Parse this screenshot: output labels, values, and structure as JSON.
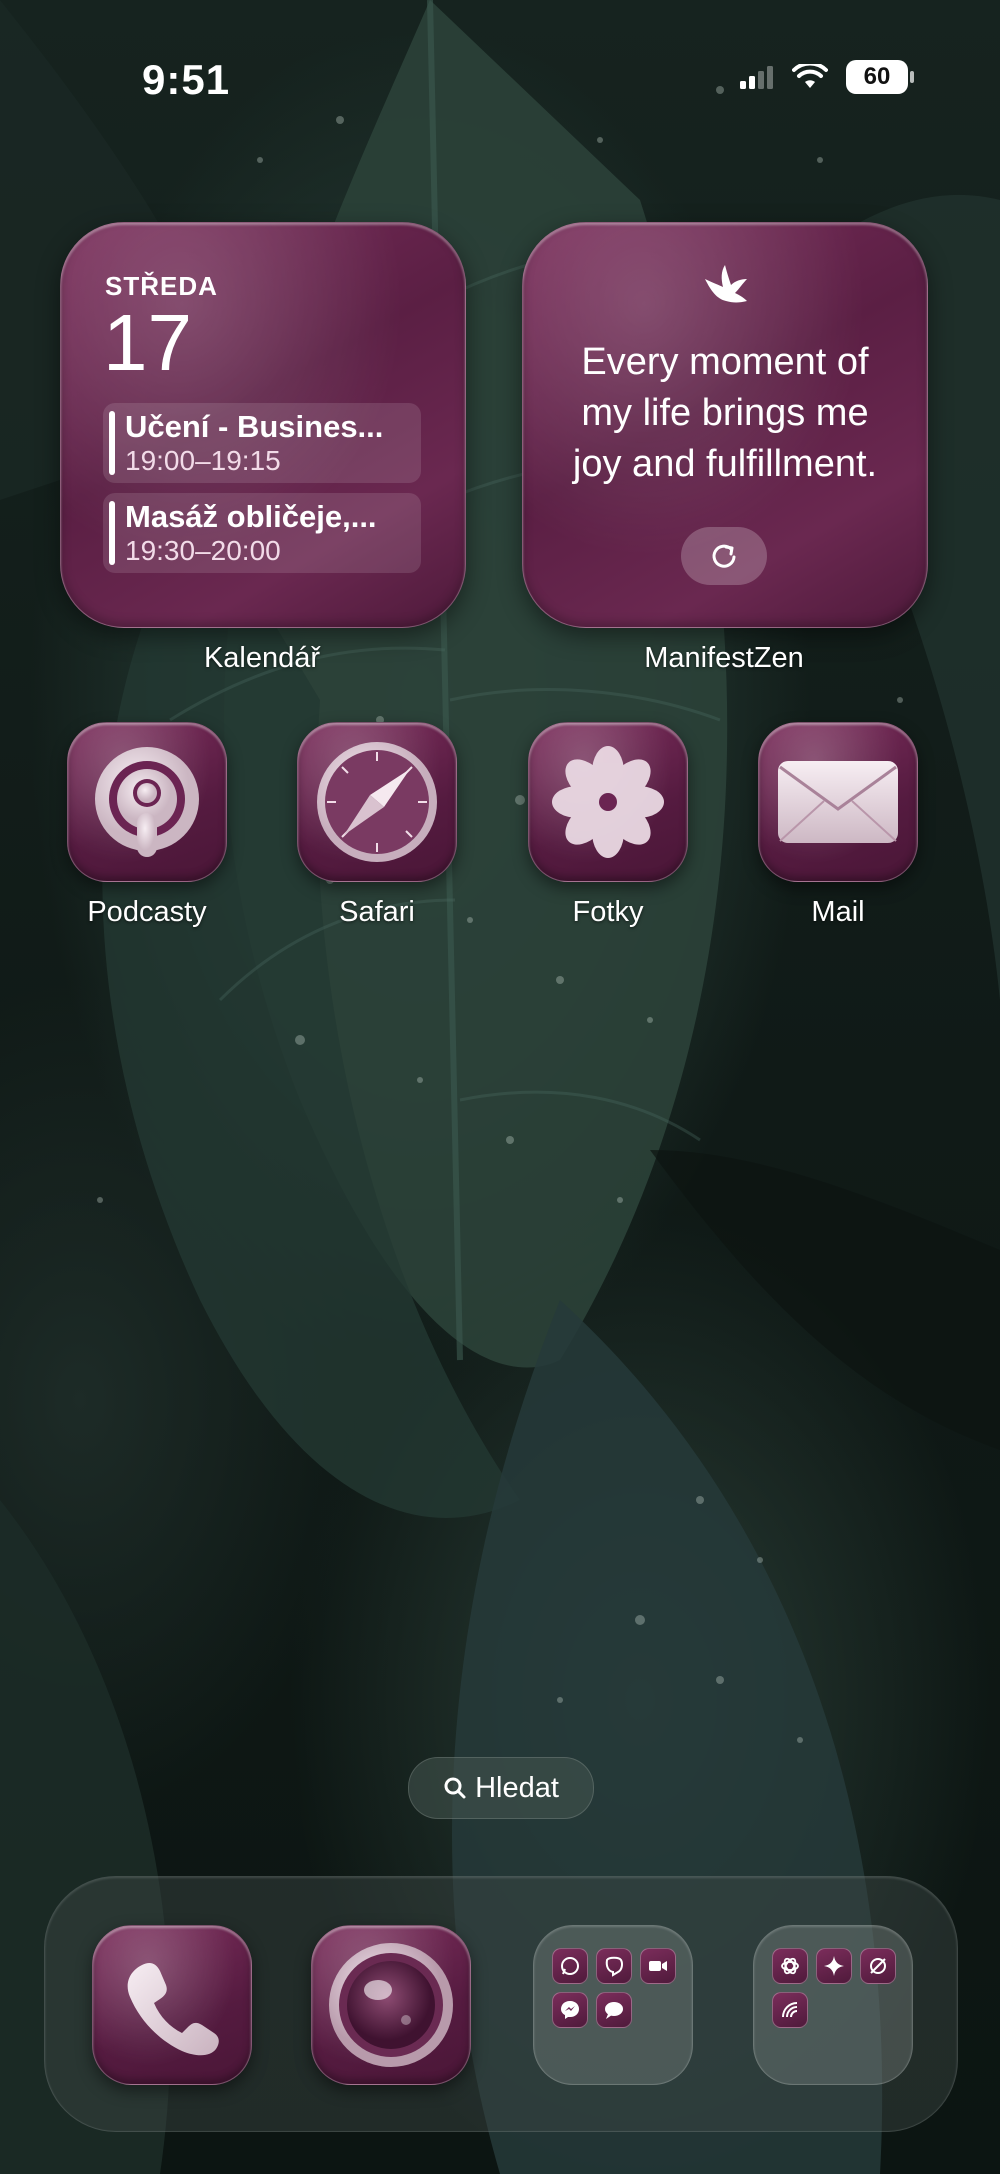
{
  "status_bar": {
    "time": "9:51",
    "battery": "60",
    "icons": [
      "cellular-signal-icon",
      "wifi-icon",
      "battery-icon"
    ]
  },
  "widgets": {
    "calendar": {
      "day": "STŘEDA",
      "date": "17",
      "events": [
        {
          "title": "Učení - Busines...",
          "time": "19:00–19:15"
        },
        {
          "title": "Masáž obličeje,...",
          "time": "19:30–20:00"
        }
      ],
      "label": "Kalendář"
    },
    "quote": {
      "lines": [
        "Every moment of",
        "my life brings me",
        "joy and fulfillment."
      ],
      "icon": "bird-icon",
      "refresh_icon": "refresh-icon",
      "label": "ManifestZen"
    }
  },
  "apps": [
    {
      "label": "Podcasty",
      "icon": "podcasts-icon"
    },
    {
      "label": "Safari",
      "icon": "compass-icon"
    },
    {
      "label": "Fotky",
      "icon": "photos-flower-icon"
    },
    {
      "label": "Mail",
      "icon": "envelope-icon"
    }
  ],
  "search": {
    "label": "Hledat",
    "icon": "search-icon"
  },
  "dock": {
    "items": [
      {
        "name": "phone",
        "icon": "phone-icon"
      },
      {
        "name": "camera",
        "icon": "camera-lens-icon"
      },
      {
        "name": "folder-messaging",
        "icons": [
          "whatsapp-icon",
          "viber-icon",
          "facetime-icon",
          "messenger-icon",
          "messages-icon"
        ]
      },
      {
        "name": "folder-ai",
        "icons": [
          "chatgpt-icon",
          "gemini-icon",
          "perplexity-icon",
          "claude-icon"
        ]
      }
    ]
  },
  "colors": {
    "accent_plum": "#6a2850",
    "wallpaper_leaf": "#2f463e"
  }
}
